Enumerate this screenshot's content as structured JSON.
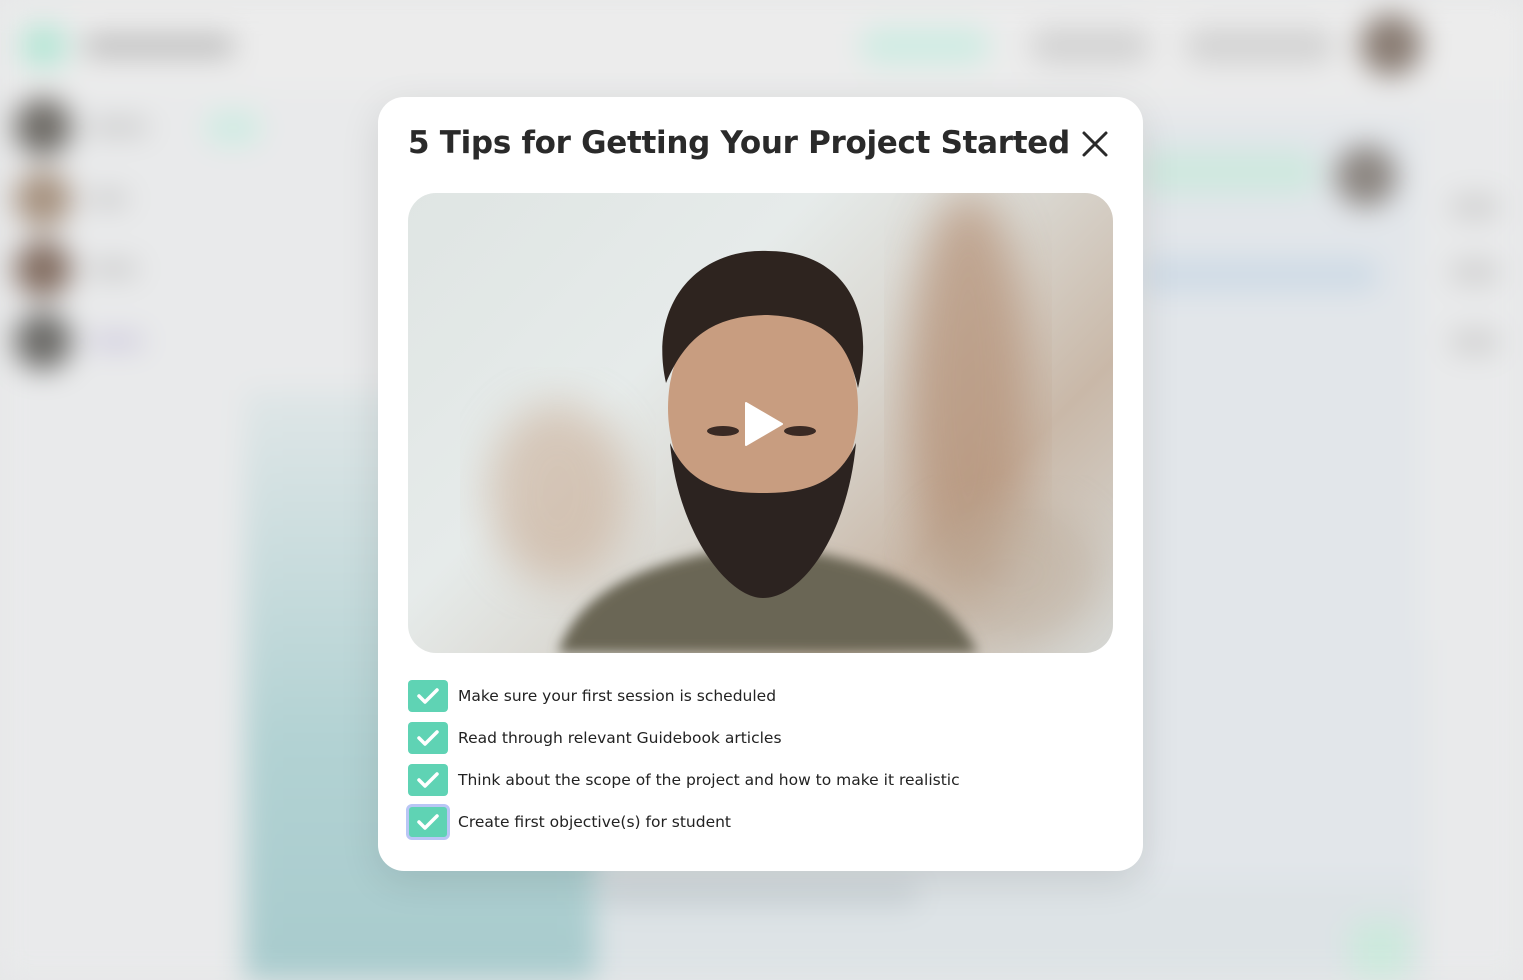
{
  "modal": {
    "title": "5 Tips for Getting Your Project Started",
    "close_icon": "close-icon",
    "video": {
      "play_icon": "play-icon"
    },
    "checklist": [
      {
        "label": "Make sure your first session is scheduled",
        "checked": true
      },
      {
        "label": "Read through relevant Guidebook articles",
        "checked": true
      },
      {
        "label": "Think about the scope of the project and how to make it realistic",
        "checked": true
      },
      {
        "label": "Create first objective(s) for student",
        "checked": true
      }
    ]
  },
  "colors": {
    "accent": "#5fd3b4",
    "focus_ring": "#b9c6f5",
    "title": "#2a2a2a",
    "modal_bg": "#ffffff"
  }
}
